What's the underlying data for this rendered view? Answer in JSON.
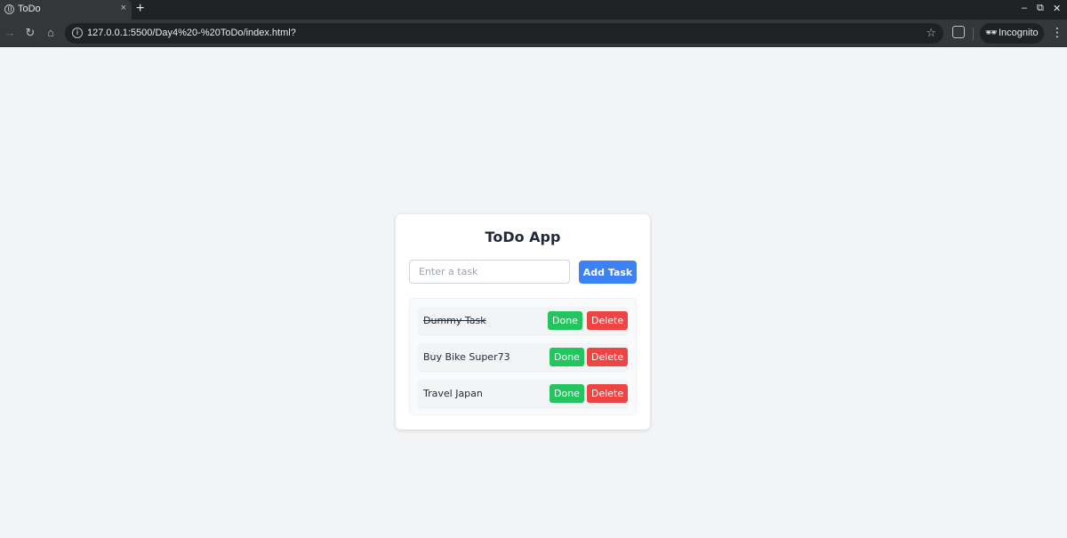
{
  "browser": {
    "tab_title": "ToDo",
    "tab_close": "×",
    "new_tab": "+",
    "url": "127.0.0.1:5500/Day4%20-%20ToDo/index.html?",
    "incognito_label": "Incognito",
    "window_controls": [
      "–",
      "⧉",
      "✕"
    ]
  },
  "app": {
    "title": "ToDo App",
    "input": {
      "placeholder": "Enter a task",
      "value": ""
    },
    "add_button_label": "Add Task",
    "tasks": [
      {
        "text": "Dummy Task",
        "completed": true,
        "done_label": "Done",
        "delete_label": "Delete"
      },
      {
        "text": "Buy Bike Super73",
        "completed": false,
        "done_label": "Done",
        "delete_label": "Delete"
      },
      {
        "text": "Travel Japan",
        "completed": false,
        "done_label": "Done",
        "delete_label": "Delete"
      }
    ]
  },
  "colors": {
    "primary": "#3b82f6",
    "done": "#22c55e",
    "delete": "#ef4444",
    "page_bg": "#f3f4f6"
  },
  "icons": [
    "globe-icon",
    "close-icon",
    "plus-icon",
    "back-icon",
    "forward-icon",
    "reload-icon",
    "home-icon",
    "info-icon",
    "star-icon",
    "extensions-icon",
    "incognito-icon",
    "menu-icon"
  ]
}
